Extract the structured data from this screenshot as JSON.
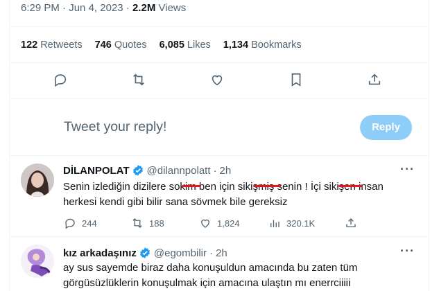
{
  "meta": {
    "time": "6:29 PM",
    "date": "Jun 4, 2023",
    "separator": "·",
    "views_count": "2.2M",
    "views_label": "Views"
  },
  "stats": [
    {
      "count": "122",
      "label": "Retweets"
    },
    {
      "count": "746",
      "label": "Quotes"
    },
    {
      "count": "6,085",
      "label": "Likes"
    },
    {
      "count": "1,134",
      "label": "Bookmarks"
    }
  ],
  "actions": [
    "reply-icon",
    "retweet-icon",
    "like-icon",
    "bookmark-icon",
    "share-icon"
  ],
  "composer": {
    "placeholder": "Tweet your reply!",
    "button": "Reply"
  },
  "replies": [
    {
      "name": "DİLANPOLAT",
      "handle": "@dilannpolatt",
      "sep": "·",
      "time": "2h",
      "text_line1": "Senin izlediğin dizilere sokim ben için sikişmiş senin ! İçi sikişen insan",
      "text_line2": "herkesi kendi gibi bilir sana sövmek bile gereksiz",
      "stats": {
        "replies": "244",
        "retweets": "188",
        "likes": "1,824",
        "views": "320.1K"
      }
    },
    {
      "name": "kız arkadaşınız",
      "handle": "@egombilir",
      "sep": "·",
      "time": "2h",
      "text_line1": "ay sus sayemde biraz daha konuşuldun amacında bu zaten tüm",
      "text_line2": "görgüsüzlüklerin konuşulmak için amacına ulaştın mı enerrciiiii"
    }
  ],
  "colors": {
    "accent": "#1d9bf0",
    "reply_button": "#8ecdf8",
    "muted": "#536471",
    "censor": "#e0191f"
  }
}
